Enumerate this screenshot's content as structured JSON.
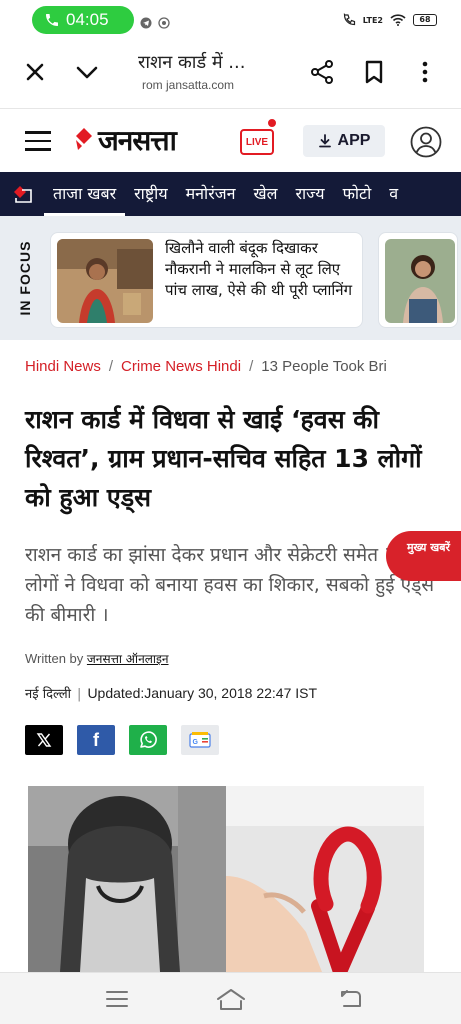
{
  "status_bar": {
    "call_time": "04:05",
    "battery": "68",
    "network": "LTE2"
  },
  "browser": {
    "page_title": "राशन कार्ड में ...",
    "url": "rom jansatta.com",
    "icons": [
      "close-icon",
      "chevron-down-icon",
      "share-icon",
      "bookmark-icon",
      "more-vert-icon"
    ]
  },
  "site_header": {
    "logo_text": "जनसत्ता",
    "live_label": "LIVE",
    "app_label": "APP",
    "icons": [
      "menu-icon",
      "download-icon",
      "user-icon"
    ]
  },
  "nav": {
    "items": [
      "ताजा खबर",
      "राष्ट्रीय",
      "मनोरंजन",
      "खेल",
      "राज्य",
      "फोटो",
      "व"
    ]
  },
  "in_focus": {
    "label": "IN FOCUS",
    "card_text": "खिलौने वाली बंदूक दिखाकर नौकरानी ने मालकिन से लूट लिए पांच लाख, ऐसे की थी पूरी प्लानिंग"
  },
  "breadcrumb": {
    "items": [
      "Hindi News",
      "Crime News Hindi",
      "13 People Took Bri"
    ]
  },
  "article": {
    "headline": "राशन कार्ड में विधवा से खाई ‘हवस की रिश्वत’, ग्राम प्रधान-सचिव सहित 13 लोगों को हुआ एड्स",
    "summary": "राशन कार्ड का झांसा देकर प्रधान और सेक्रेटरी समेत 13 लोगों ने विधवा को बनाया हवस का शिकार, सबको हुई एड्स की बीमारी ।",
    "byline_prefix": "Written by",
    "author": "जनसत्ता ऑनलाइन",
    "place": "नई दिल्ली",
    "updated": "Updated:January 30, 2018 22:47 IST"
  },
  "breaking_tab": {
    "label": "मुख्य खबरें"
  },
  "share": {
    "facebook": "f",
    "google_news": "G"
  },
  "colors": {
    "brand_red": "#d42027",
    "nav_bg": "#141a38",
    "call_green": "#2ecc40"
  }
}
